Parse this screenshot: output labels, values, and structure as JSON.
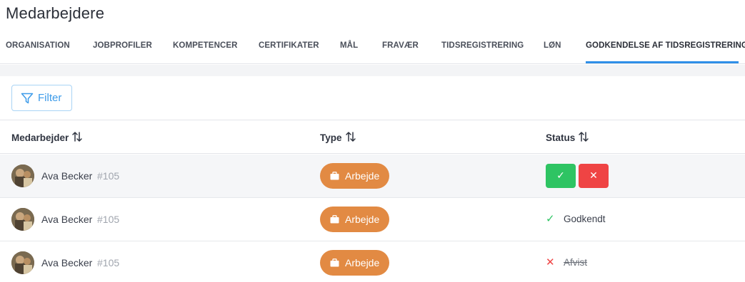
{
  "page": {
    "title": "Medarbejdere"
  },
  "tabs": [
    {
      "label": "ORGANISATION"
    },
    {
      "label": "JOBPROFILER"
    },
    {
      "label": "KOMPETENCER"
    },
    {
      "label": "CERTIFIKATER"
    },
    {
      "label": "MÅL"
    },
    {
      "label": "FRAVÆR"
    },
    {
      "label": "TIDSREGISTRERING"
    },
    {
      "label": "LØN"
    },
    {
      "label": "GODKENDELSE AF TIDSREGISTRERING",
      "active": true
    }
  ],
  "filter": {
    "label": "Filter",
    "icon": "filter-icon"
  },
  "table": {
    "columns": [
      {
        "label": "Medarbejder",
        "sort_icon": "sort-icon"
      },
      {
        "label": "Type",
        "sort_icon": "sort-icon"
      },
      {
        "label": "Status",
        "sort_icon": "sort-icon"
      }
    ],
    "rows": [
      {
        "name": "Ava Becker",
        "id": "#105",
        "type": "Arbejde",
        "type_icon": "briefcase-icon",
        "status": "pending",
        "approve_glyph": "✓",
        "reject_glyph": "✕"
      },
      {
        "name": "Ava Becker",
        "id": "#105",
        "type": "Arbejde",
        "type_icon": "briefcase-icon",
        "status": "approved",
        "status_glyph": "✓",
        "status_label": "Godkendt"
      },
      {
        "name": "Ava Becker",
        "id": "#105",
        "type": "Arbejde",
        "type_icon": "briefcase-icon",
        "status": "rejected",
        "status_glyph": "✕",
        "status_label": "Afvist"
      }
    ]
  },
  "colors": {
    "accent": "#2f8fe8",
    "filter": "#3d9be9",
    "type_pill": "#e28a43",
    "approve": "#2ec463",
    "reject": "#ef4444"
  }
}
